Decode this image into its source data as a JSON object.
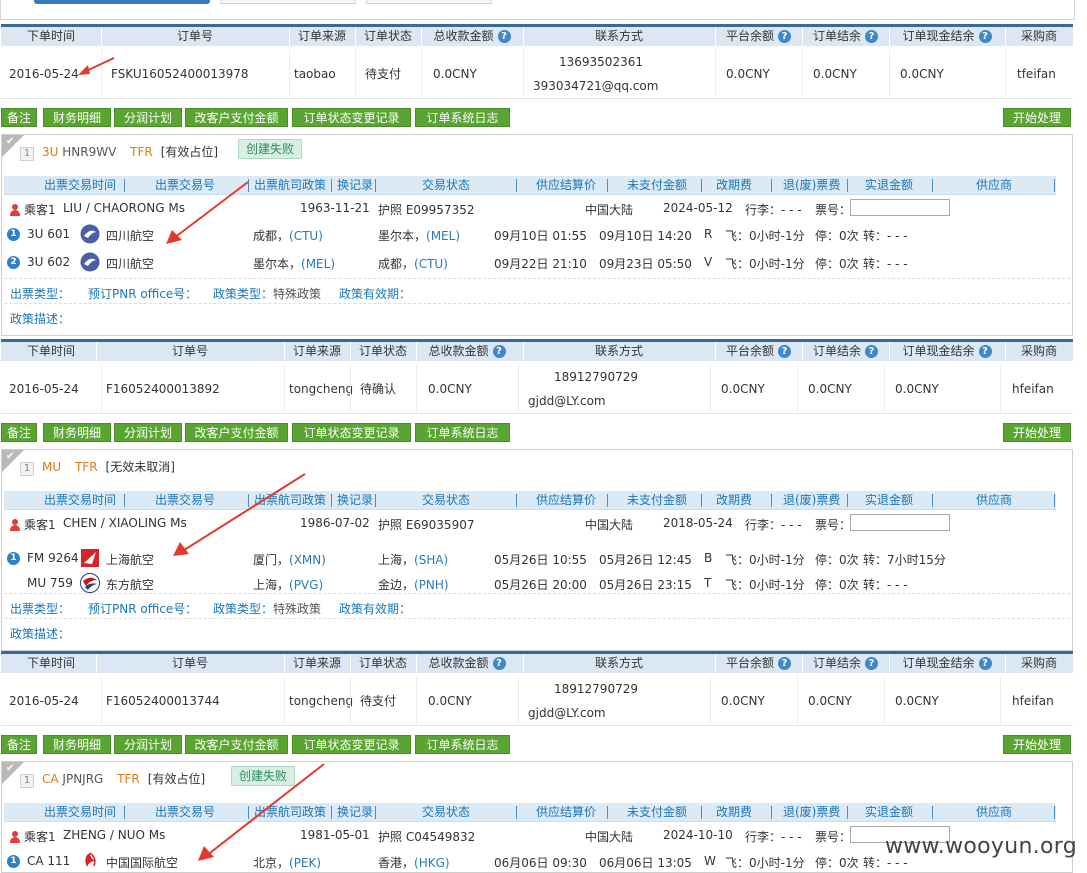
{
  "window": {
    "watermark": "www.wooyun.org"
  },
  "order_header": {
    "time": "下单时间",
    "order_no": "订单号",
    "source": "订单来源",
    "status": "订单状态",
    "total": "总收款金额",
    "contact": "联系方式",
    "platform_balance": "平台余额",
    "settle": "订单结余",
    "cash_settle": "订单现金结余",
    "buyer": "采购商",
    "help_icon": "?"
  },
  "buttons": {
    "remark": "备注",
    "finance": "财务明细",
    "profit_plan": "分润计划",
    "change_pay": "改客户支付金额",
    "status_log": "订单状态变更记录",
    "sys_log": "订单系统日志",
    "start": "开始处理"
  },
  "flight_header": {
    "issue_time": "出票交易时间",
    "issue_no": "出票交易号",
    "airline_policy": "出票航司政策",
    "change_record": "换记录",
    "trade_status": "交易状态",
    "supplier_price": "供应结算价",
    "unpaid": "未支付金额",
    "change_fee": "改期费",
    "refund_fee": "退(废)票费",
    "refund_amount": "实退金额",
    "supplier": "供应商"
  },
  "labels": {
    "luggage": "行李：- - -",
    "ticket_no": "票号：",
    "fly": "飞：0小时-1分",
    "stop": "停：0次",
    "transfer": "转：",
    "issue_type": "出票类型：",
    "pnr_office": "预订PNR office号：",
    "policy_type": "政策类型：",
    "policy_type_val": "特殊政策",
    "policy_valid": "政策有效期：",
    "policy_desc": "政策描述："
  },
  "orders": [
    {
      "time": "2016-05-24",
      "order_no": "FSKU16052400013978",
      "source": "taobao",
      "status": "待支付",
      "total": "0.0CNY",
      "phone": "13693502361",
      "email": "393034721@qq.com",
      "platform_balance": "0.0CNY",
      "settle": "0.0CNY",
      "cash_settle": "0.0CNY",
      "buyer": "tfeifan",
      "detail": {
        "num": "1",
        "airline_code": "3U",
        "pnr": "HNR9WV",
        "type": "TFR",
        "state": "[有效占位]",
        "badge": "创建失败",
        "passenger": {
          "label": "乘客1",
          "name": "LIU / CHAORONG Ms",
          "birth": "1963-11-21",
          "doc": "护照 E09957352",
          "nation": "中国大陆",
          "expiry": "2024-05-12"
        },
        "flights": [
          {
            "seq": "1",
            "flight": "3U 601",
            "airline": "四川航空",
            "from": "成都，",
            "from_code": "(CTU)",
            "to": "墨尔本，",
            "to_code": "(MEL)",
            "dep": "09月10日 01:55",
            "arr": "09月10日 14:20",
            "cabin": "R",
            "transfer": "- - -"
          },
          {
            "seq": "2",
            "flight": "3U 602",
            "airline": "四川航空",
            "from": "墨尔本，",
            "from_code": "(MEL)",
            "to": "成都，",
            "to_code": "(CTU)",
            "dep": "09月22日 21:10",
            "arr": "09月23日 05:50",
            "cabin": "V",
            "transfer": "- - -"
          }
        ]
      }
    },
    {
      "time": "2016-05-24",
      "order_no": "F16052400013892",
      "source": "tongcheng",
      "status": "待确认",
      "total": "0.0CNY",
      "phone": "18912790729",
      "email": "gjdd@LY.com",
      "platform_balance": "0.0CNY",
      "settle": "0.0CNY",
      "cash_settle": "0.0CNY",
      "buyer": "hfeifan",
      "detail": {
        "num": "1",
        "airline_code": "MU",
        "pnr": "",
        "type": "TFR",
        "state": "[无效未取消]",
        "badge": "",
        "passenger": {
          "label": "乘客1",
          "name": "CHEN / XIAOLING Ms",
          "birth": "1986-07-02",
          "doc": "护照 E69035907",
          "nation": "中国大陆",
          "expiry": "2018-05-24"
        },
        "flights": [
          {
            "seq": "1",
            "flight": "FM 9264",
            "airline": "上海航空",
            "from": "厦门，",
            "from_code": "(XMN)",
            "to": "上海，",
            "to_code": "(SHA)",
            "dep": "05月26日 10:55",
            "arr": "05月26日 12:45",
            "cabin": "B",
            "transfer": "7小时15分"
          },
          {
            "seq": "",
            "flight": "MU 759",
            "airline": "东方航空",
            "from": "上海，",
            "from_code": "(PVG)",
            "to": "金边，",
            "to_code": "(PNH)",
            "dep": "05月26日 20:00",
            "arr": "05月26日 23:15",
            "cabin": "T",
            "transfer": "- - -"
          }
        ]
      }
    },
    {
      "time": "2016-05-24",
      "order_no": "F16052400013744",
      "source": "tongcheng",
      "status": "待支付",
      "total": "0.0CNY",
      "phone": "18912790729",
      "email": "gjdd@LY.com",
      "platform_balance": "0.0CNY",
      "settle": "0.0CNY",
      "cash_settle": "0.0CNY",
      "buyer": "hfeifan",
      "detail": {
        "num": "1",
        "airline_code": "CA",
        "pnr": "JPNJRG",
        "type": "TFR",
        "state": "[有效占位]",
        "badge": "创建失败",
        "passenger": {
          "label": "乘客1",
          "name": "ZHENG / NUO Ms",
          "birth": "1981-05-01",
          "doc": "护照 C04549832",
          "nation": "中国大陆",
          "expiry": "2024-10-10"
        },
        "flights": [
          {
            "seq": "1",
            "flight": "CA 111",
            "airline": "中国国际航空",
            "from": "北京，",
            "from_code": "(PEK)",
            "to": "香港，",
            "to_code": "(HKG)",
            "dep": "06月06日 09:30",
            "arr": "06月06日 13:05",
            "cabin": "W",
            "transfer": "- - -"
          }
        ]
      }
    }
  ]
}
